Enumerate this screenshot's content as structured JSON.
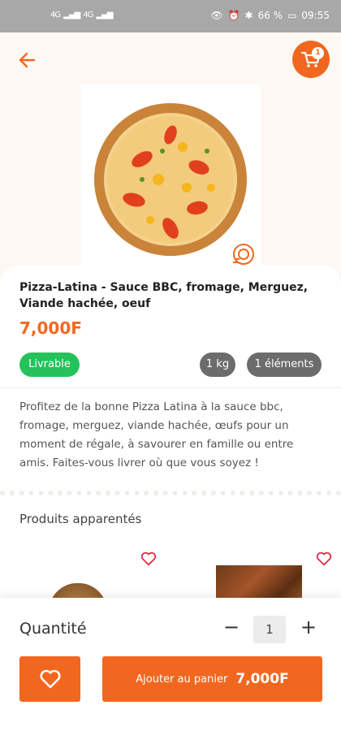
{
  "status_bar": {
    "network": "4G",
    "battery": "66 %",
    "time": "09:55"
  },
  "product": {
    "title": "Pizza-Latina - Sauce BBC, fromage, Merguez, Viande hachée, oeuf",
    "price": "7,000F",
    "chips": {
      "availability": "Livrable",
      "weight": "1 kg",
      "items": "1 éléments"
    },
    "description": "Profitez de la bonne Pizza Latina à la sauce bbc, fromage, merguez, viande hachée, œufs pour un moment de régale, à savourer en famille ou entre amis. Faites-vous livrer où que vous soyez !"
  },
  "cart": {
    "badge_count": "1"
  },
  "related": {
    "title": "Produits apparentés"
  },
  "bottom_bar": {
    "quantity_label": "Quantité",
    "quantity_value": "1",
    "minus": "−",
    "plus": "+",
    "add_label": "Ajouter au panier",
    "add_price": "7,000F"
  },
  "colors": {
    "accent": "#f2671f",
    "available": "#25c25b",
    "chip_grey": "#6c6c6c"
  },
  "icons": [
    "back-arrow-icon",
    "cart-icon",
    "delivery-icon",
    "heart-icon"
  ]
}
